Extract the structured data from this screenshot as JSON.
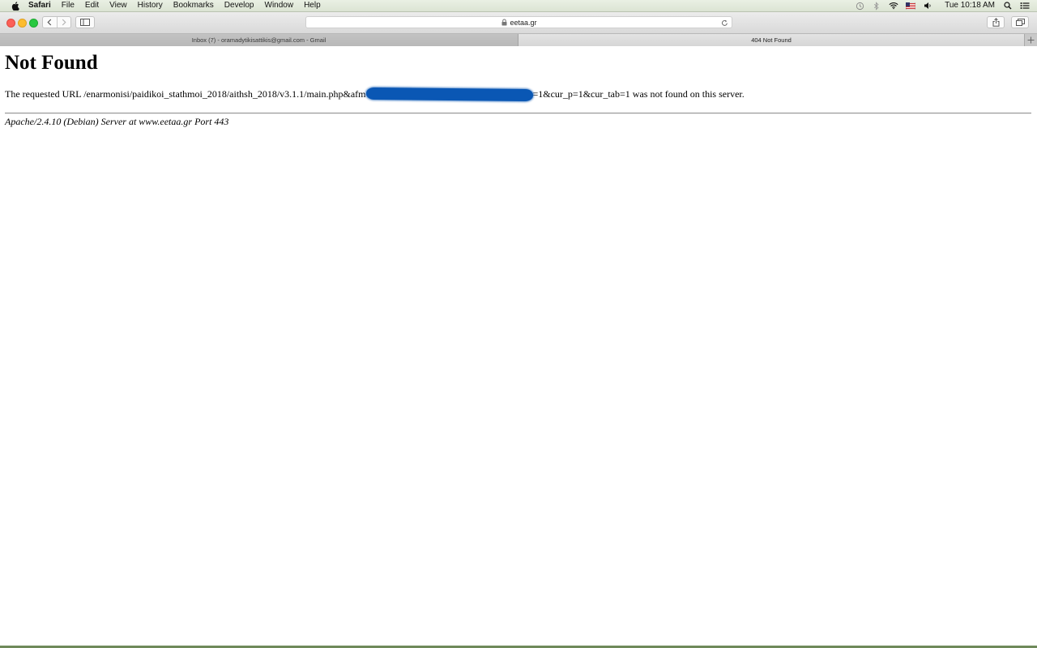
{
  "menubar": {
    "app_name": "Safari",
    "items": [
      "File",
      "Edit",
      "View",
      "History",
      "Bookmarks",
      "Develop",
      "Window",
      "Help"
    ],
    "clock": "Tue 10:18 AM",
    "status_icons": [
      "time-machine-icon",
      "bluetooth-icon",
      "wifi-icon",
      "us-flag-icon",
      "volume-icon",
      "spotlight-icon",
      "notification-center-icon"
    ]
  },
  "toolbar": {
    "address_text": "eetaa.gr"
  },
  "tabs": [
    {
      "title": "Inbox (7) - oramadytikisattikis@gmail.com - Gmail",
      "active": false
    },
    {
      "title": "404 Not Found",
      "active": true
    }
  ],
  "page": {
    "heading": "Not Found",
    "message_before": "The requested URL /enarmonisi/paidikoi_stathmoi_2018/aithsh_2018/v3.1.1/main.php&afm",
    "message_after": "=1&cur_p=1&cur_tab=1 was not found on this server.",
    "server_signature": "Apache/2.4.10 (Debian) Server at www.eetaa.gr Port 443"
  },
  "colors": {
    "redaction": "#0a57b4",
    "close": "#fc5f57",
    "minimize": "#fdbc2e",
    "maximize": "#28c840"
  }
}
